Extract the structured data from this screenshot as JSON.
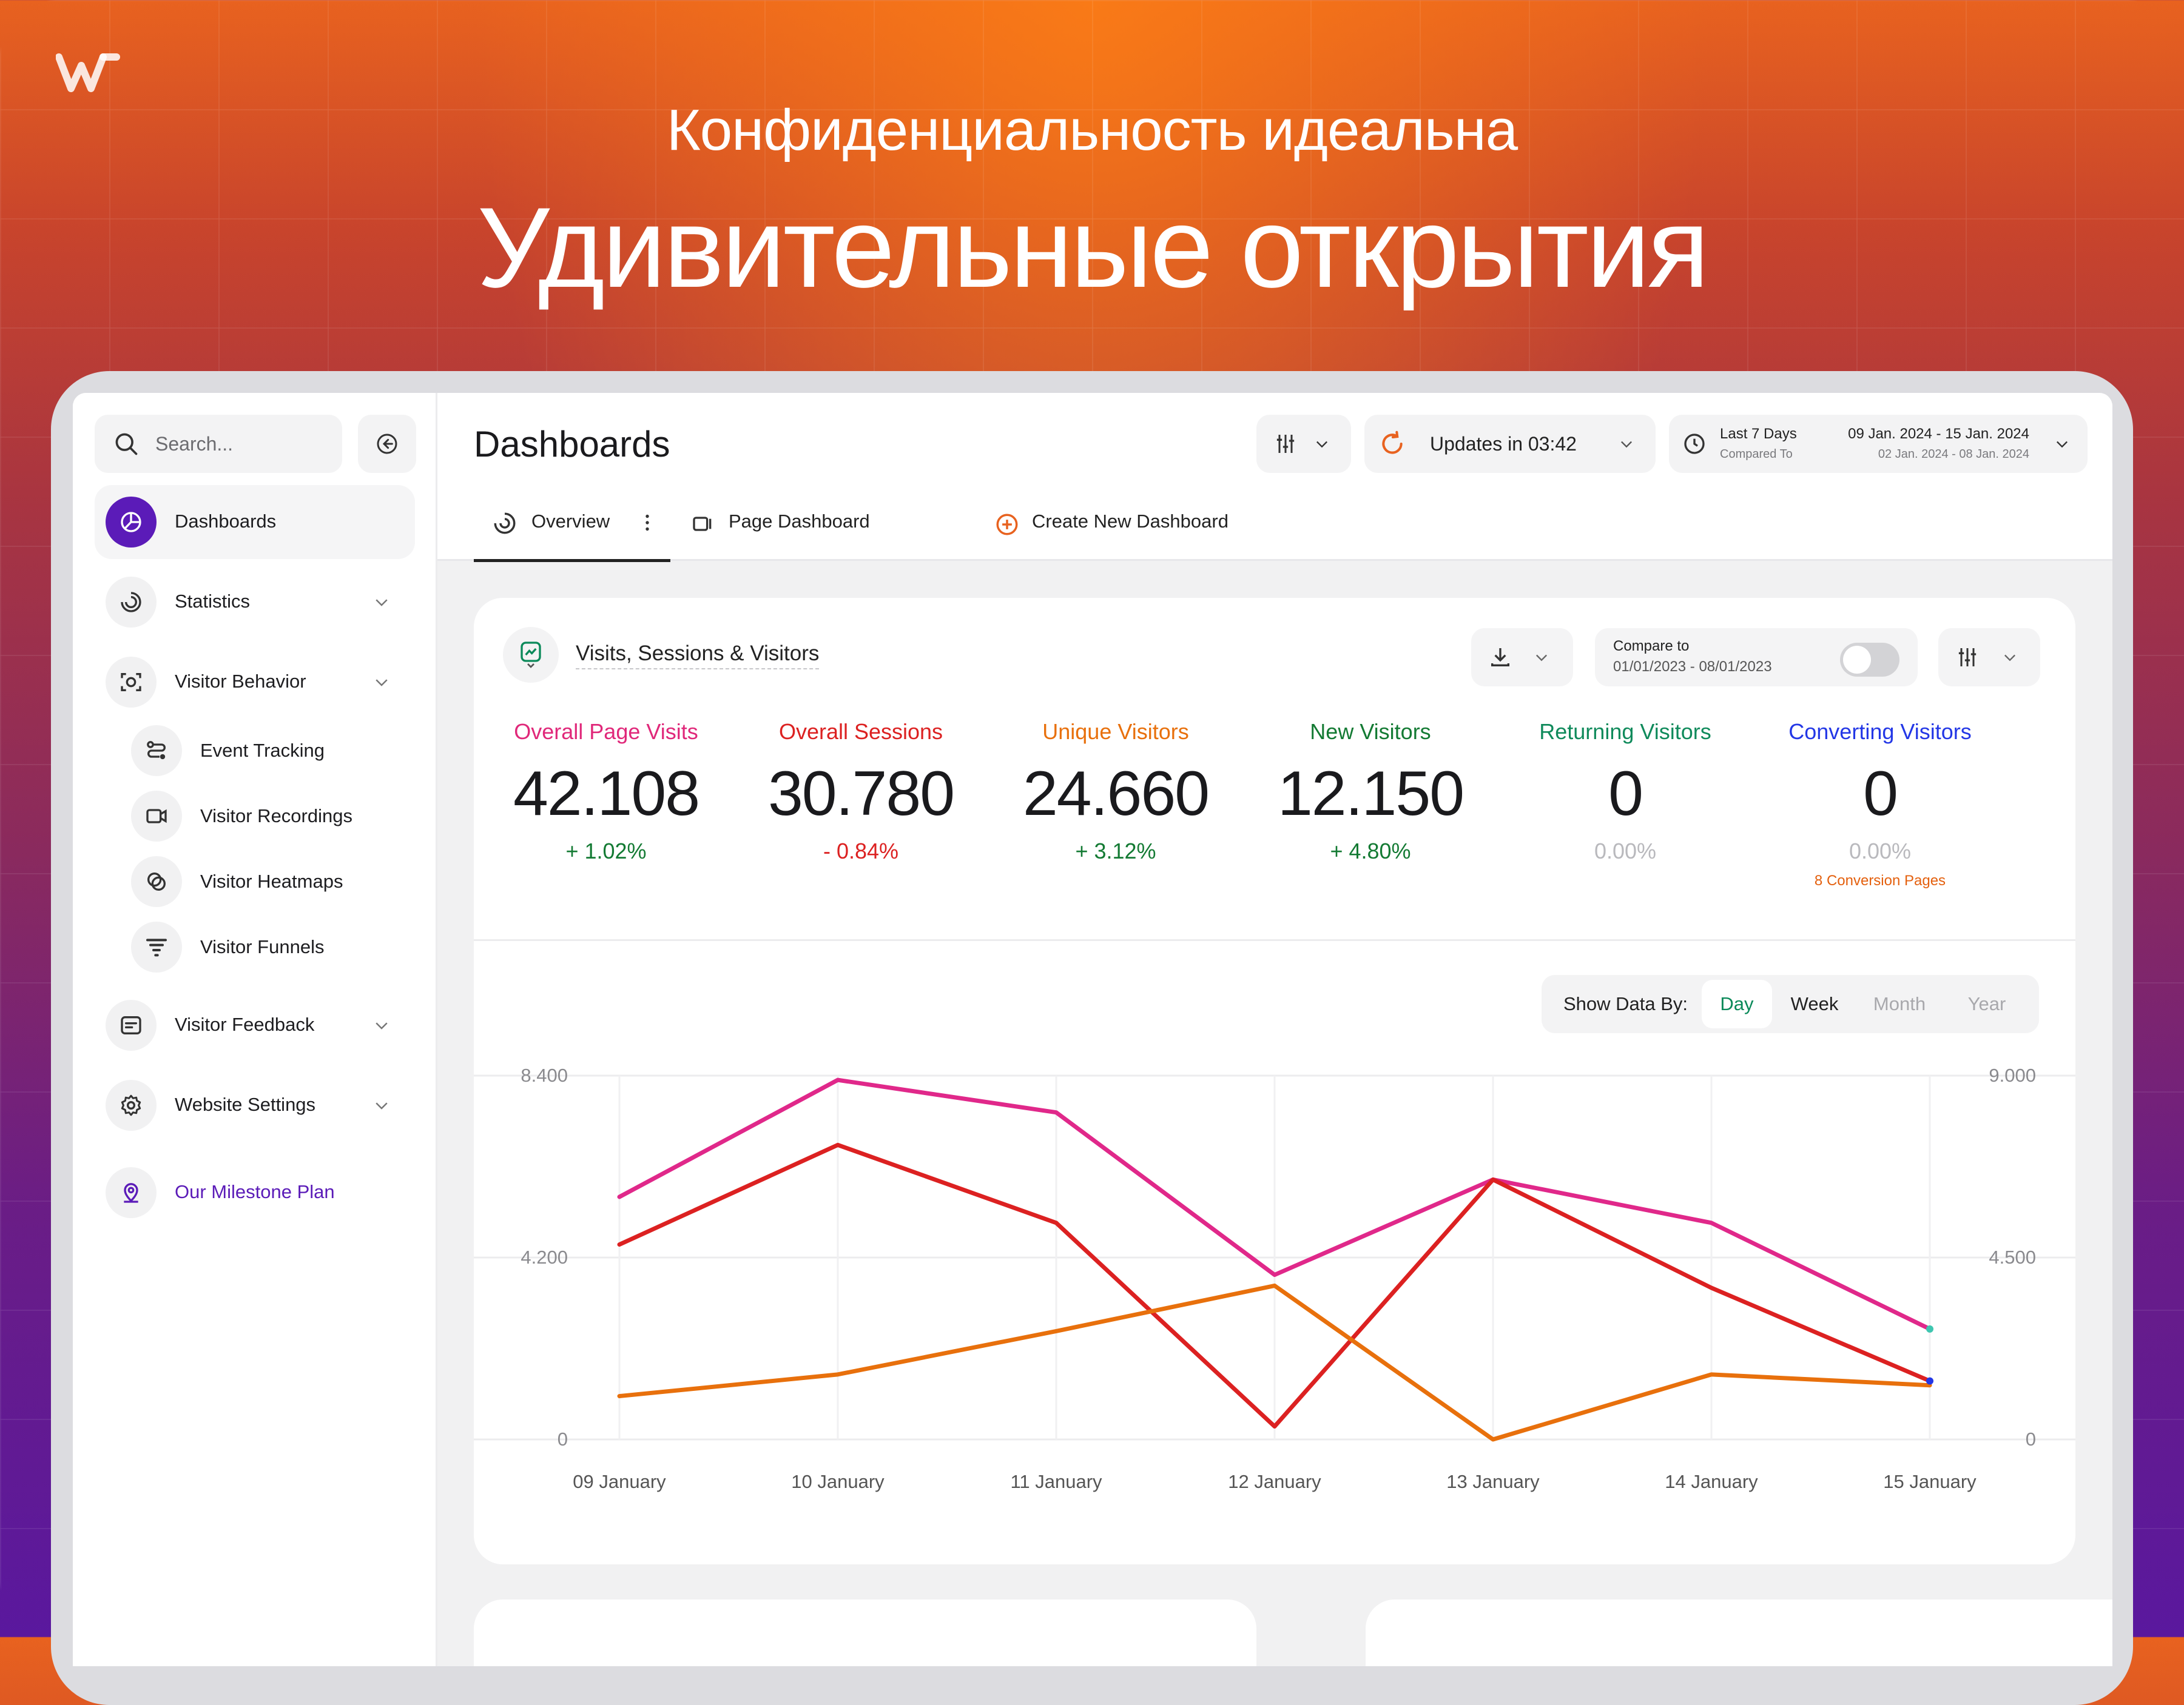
{
  "hero": {
    "subtitle": "Конфиденциальность идеальна",
    "title": "Удивительные открытия"
  },
  "sidebar": {
    "search_placeholder": "Search...",
    "items": [
      {
        "label": "Dashboards",
        "icon": "pie-chart-icon",
        "active": true
      },
      {
        "label": "Statistics",
        "icon": "statistics-icon"
      },
      {
        "label": "Visitor Behavior",
        "icon": "visitor-behavior-icon"
      },
      {
        "label": "Event Tracking",
        "icon": "event-tracking-icon"
      },
      {
        "label": "Visitor Recordings",
        "icon": "video-icon"
      },
      {
        "label": "Visitor Heatmaps",
        "icon": "heatmap-icon"
      },
      {
        "label": "Visitor Funnels",
        "icon": "funnel-icon"
      },
      {
        "label": "Visitor Feedback",
        "icon": "feedback-icon"
      },
      {
        "label": "Website Settings",
        "icon": "gear-icon"
      },
      {
        "label": "Our Milestone Plan",
        "icon": "map-pin-icon"
      }
    ]
  },
  "header": {
    "title": "Dashboards",
    "update_text": "Updates in 03:42",
    "range_label": "Last 7 Days",
    "compared_label": "Compared To",
    "range_dates": "09 Jan. 2024 - 15 Jan. 2024",
    "compared_dates": "02 Jan. 2024 - 08 Jan. 2024"
  },
  "tabs": [
    {
      "label": "Overview",
      "active": true
    },
    {
      "label": "Page Dashboard"
    },
    {
      "label": "Create New Dashboard"
    }
  ],
  "card": {
    "title": "Visits, Sessions & Visitors",
    "compare_label": "Compare to",
    "compare_dates": "01/01/2023 - 08/01/2023",
    "compare_enabled": false
  },
  "stats": [
    {
      "label": "Overall Page Visits",
      "value": "42.108",
      "delta": "+ 1.02%",
      "color": "#e0287a",
      "delta_color": "#137a33"
    },
    {
      "label": "Overall Sessions",
      "value": "30.780",
      "delta": "- 0.84%",
      "color": "#dc2121",
      "delta_color": "#dc2121"
    },
    {
      "label": "Unique Visitors",
      "value": "24.660",
      "delta": "+ 3.12%",
      "color": "#e8700c",
      "delta_color": "#137a33"
    },
    {
      "label": "New Visitors",
      "value": "12.150",
      "delta": "+ 4.80%",
      "color": "#137a33",
      "delta_color": "#137a33"
    },
    {
      "label": "Returning Visitors",
      "value": "0",
      "delta": "0.00%",
      "color": "#0f8a5b",
      "delta_color": "#b9b9bd"
    },
    {
      "label": "Converting Visitors",
      "value": "0",
      "delta": "0.00%",
      "color": "#2337e6",
      "delta_color": "#b9b9bd",
      "extra": "8 Conversion Pages"
    }
  ],
  "show_data_by": {
    "label": "Show Data By:",
    "options": [
      "Day",
      "Week",
      "Month",
      "Year"
    ],
    "selected": "Day"
  },
  "chart_data": {
    "type": "line",
    "categories": [
      "09 January",
      "10 January",
      "11 January",
      "12 January",
      "13 January",
      "14 January",
      "15 January"
    ],
    "y_left": {
      "ticks": [
        "8.400",
        "4.200",
        "0"
      ],
      "range": [
        0,
        8400
      ]
    },
    "y_right": {
      "ticks": [
        "9.000",
        "4.500",
        "0"
      ],
      "range": [
        0,
        9000
      ]
    },
    "grid": true,
    "series": [
      {
        "color": "#e0288a",
        "axis": "left",
        "values": [
          5600,
          8300,
          7550,
          3800,
          6000,
          5000,
          2550
        ]
      },
      {
        "color": "#dc2121",
        "axis": "left",
        "values": [
          4500,
          6800,
          5000,
          300,
          6000,
          3500,
          1350
        ]
      },
      {
        "color": "#e8700c",
        "axis": "left",
        "values": [
          1000,
          1500,
          2500,
          3550,
          0,
          1500,
          1250
        ]
      }
    ]
  },
  "colors": {
    "accent_purple": "#5b1bb8",
    "accent_orange": "#e8621f",
    "positive": "#137a33"
  }
}
